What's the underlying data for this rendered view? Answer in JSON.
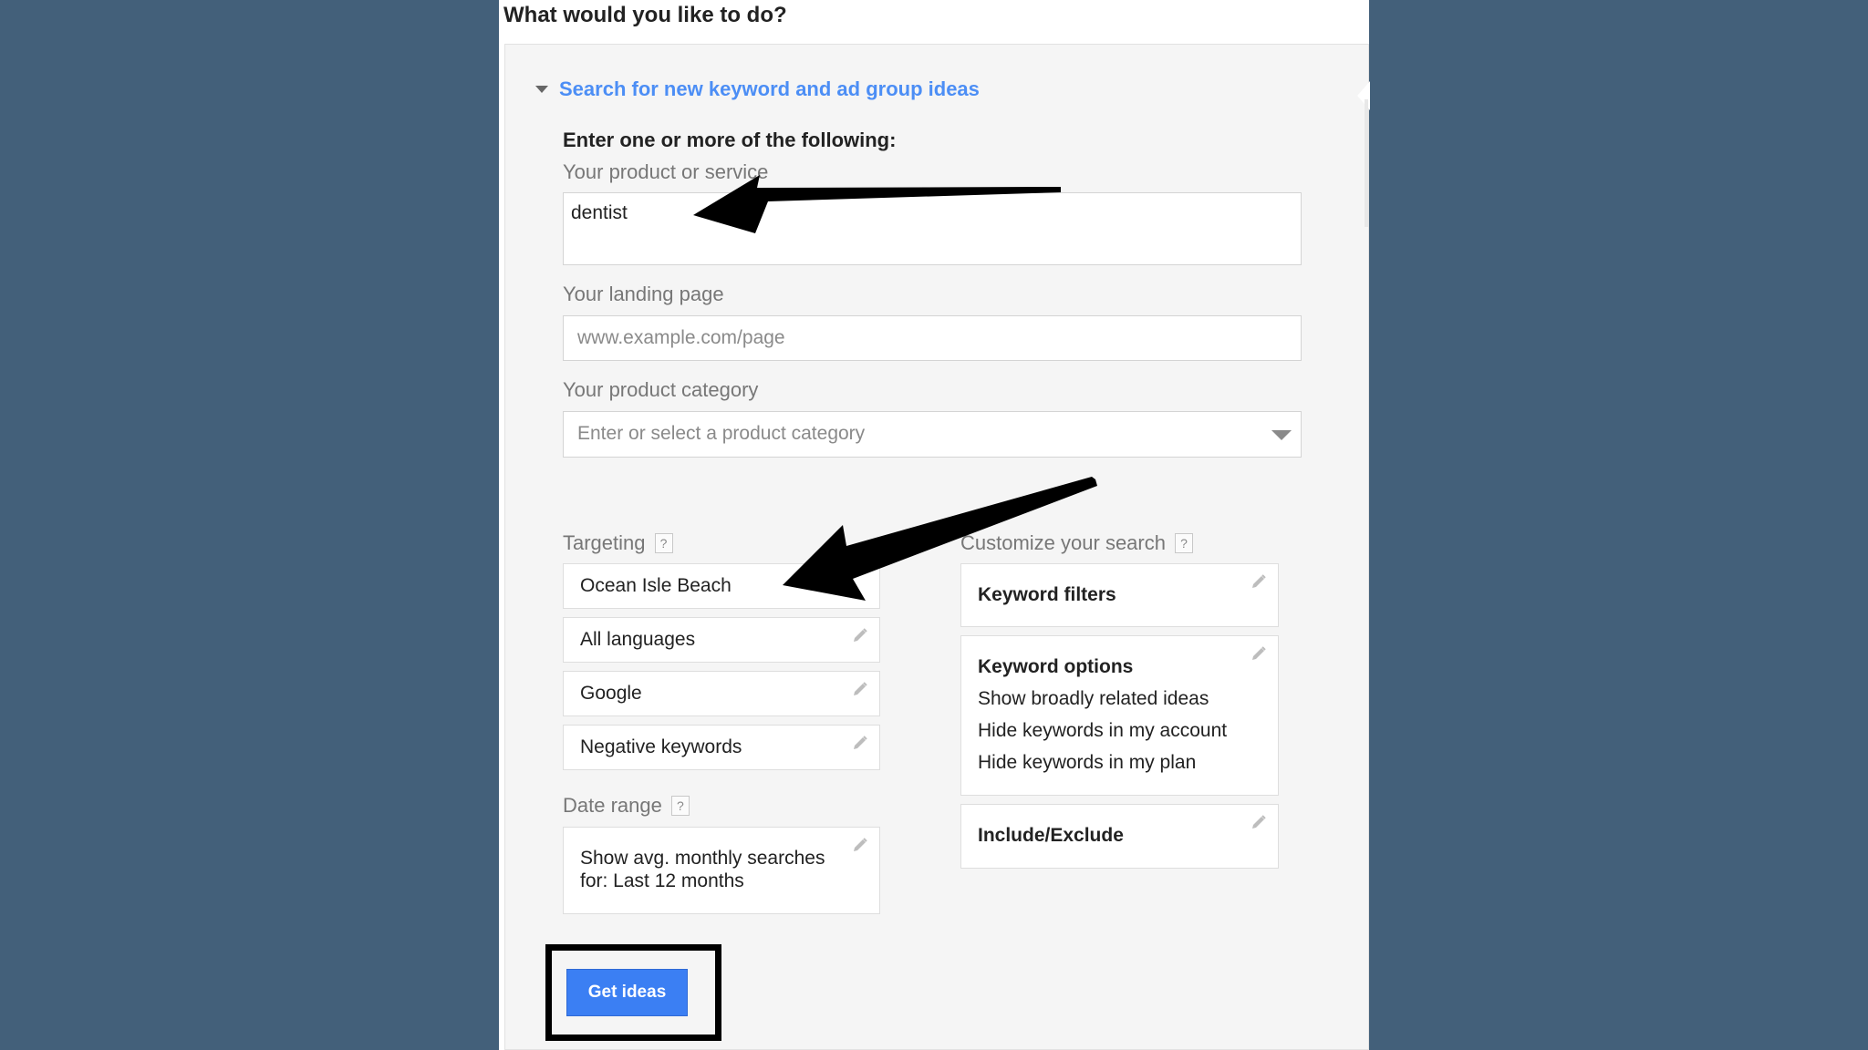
{
  "heading": "What would you like to do?",
  "section": {
    "title": "Search for new keyword and ad group ideas"
  },
  "form": {
    "instructions": "Enter one or more of the following:",
    "product": {
      "label": "Your product or service",
      "value": "dentist"
    },
    "landing": {
      "label": "Your landing page",
      "placeholder": "www.example.com/page"
    },
    "category": {
      "label": "Your product category",
      "placeholder": "Enter or select a product category"
    }
  },
  "targeting": {
    "label": "Targeting",
    "help": "?",
    "items": [
      {
        "label": "Ocean Isle Beach"
      },
      {
        "label": "All languages"
      },
      {
        "label": "Google"
      },
      {
        "label": "Negative keywords"
      }
    ]
  },
  "date_range": {
    "label": "Date range",
    "help": "?",
    "value": "Show avg. monthly searches for: Last 12 months"
  },
  "customize": {
    "label": "Customize your search",
    "help": "?",
    "keyword_filters": {
      "title": "Keyword filters"
    },
    "keyword_options": {
      "title": "Keyword options",
      "options": [
        "Show broadly related ideas",
        "Hide keywords in my account",
        "Hide keywords in my plan"
      ]
    },
    "include_exclude": {
      "title": "Include/Exclude"
    }
  },
  "actions": {
    "get_ideas": "Get ideas"
  },
  "icons": {
    "edit": "pencil-icon",
    "collapse": "caret-down-icon",
    "dropdown": "chevron-down-icon",
    "help": "help-icon",
    "annotations": "arrow-icon"
  },
  "colors": {
    "background": "#43607a",
    "accent": "#4c8ef5",
    "button": "#3b7ff3"
  }
}
